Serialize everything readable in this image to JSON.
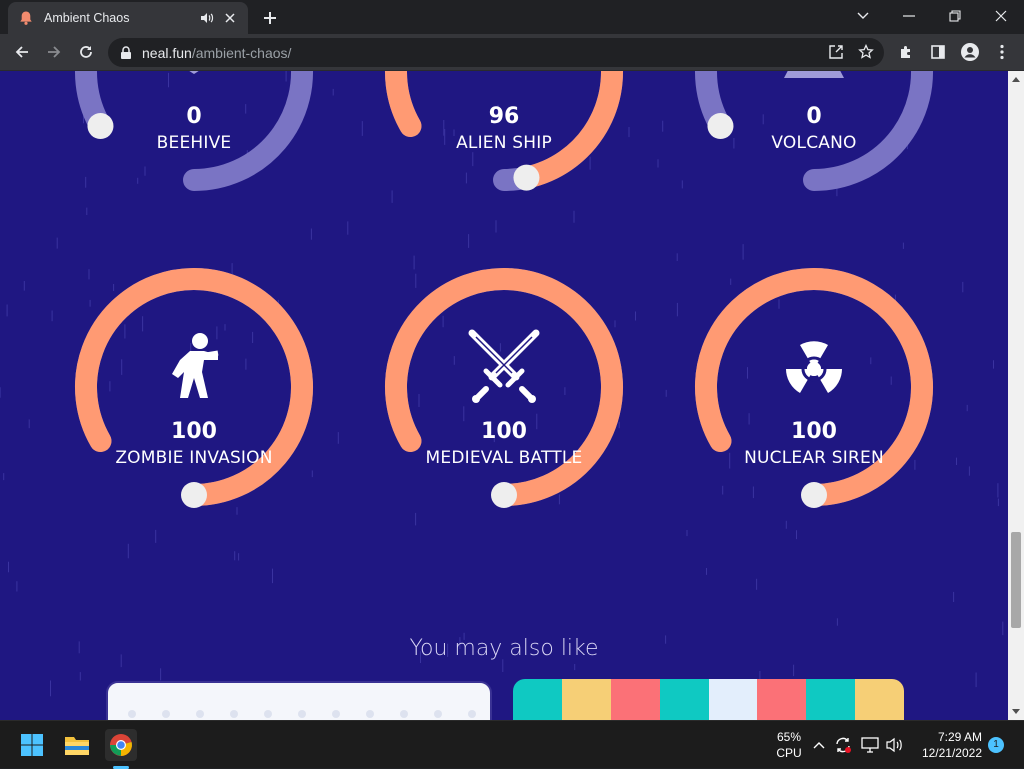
{
  "browser": {
    "tab_title": "Ambient Chaos",
    "url_host": "neal.fun",
    "url_path": "/ambient-chaos/"
  },
  "sounds": [
    {
      "name": "BEEHIVE",
      "value": "0",
      "level": 0,
      "icon": "beehive-icon"
    },
    {
      "name": "ALIEN SHIP",
      "value": "96",
      "level": 0.96,
      "icon": "alien-ship-icon"
    },
    {
      "name": "VOLCANO",
      "value": "0",
      "level": 0,
      "icon": "volcano-icon"
    },
    {
      "name": "ZOMBIE INVASION",
      "value": "100",
      "level": 1,
      "icon": "zombie-icon"
    },
    {
      "name": "MEDIEVAL BATTLE",
      "value": "100",
      "level": 1,
      "icon": "crossed-swords-icon"
    },
    {
      "name": "NUCLEAR SIREN",
      "value": "100",
      "level": 1,
      "icon": "radiation-icon"
    }
  ],
  "also_like": "You may also like",
  "colors": {
    "page_bg": "#1f1782",
    "dial_active": "#ff9a73",
    "dial_inactive": "#7a74c4",
    "knob": "#eeeeee"
  },
  "card_stripes": [
    "#0fc9c2",
    "#f6cf76",
    "#fb7177",
    "#0fc9c2",
    "#e3eefc",
    "#fb7177",
    "#0fc9c2",
    "#f6cf76"
  ],
  "taskbar": {
    "cpu_percent": "65%",
    "cpu_label": "CPU",
    "time": "7:29 AM",
    "date": "12/21/2022",
    "notifications": "1"
  }
}
